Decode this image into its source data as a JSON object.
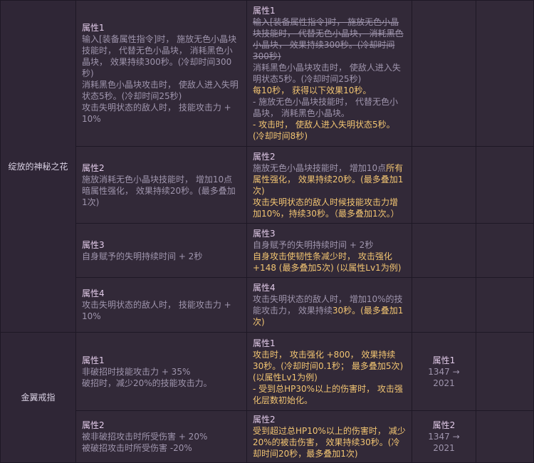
{
  "items": [
    {
      "name": "绽放的神秘之花",
      "rows": [
        {
          "old": {
            "title": "属性1",
            "lines": [
              "输入[装备属性指令]时， 施放无色小晶块技能时， 代替无色小晶块， 消耗黑色小晶块， 效果持续300秒。(冷却时间300秒)",
              "消耗黑色小晶块攻击时， 使敌人进入失明状态5秒。(冷却时间25秒)",
              "攻击失明状态的敌人时， 技能攻击力 + 10%"
            ]
          },
          "new": {
            "title": "属性1",
            "struck": "输入[装备属性指令]时， 施放无色小晶块技能时， 代替无色小晶块， 消耗黑色小晶块， 效果持续300秒。(冷却时间300秒)",
            "gray": "消耗黑色小晶块攻击时， 使敌人进入失明状态5秒。(冷却时间25秒)",
            "y1": "每10秒， 获得以下效果10秒。",
            "gray2": "- 施放无色小晶块技能时， 代替无色小晶块， 消耗黑色小晶块。",
            "y2": "- 攻击时， 使敌人进入失明状态5秒。(冷却时间8秒)"
          }
        },
        {
          "old": {
            "title": "属性2",
            "lines": [
              "施放消耗无色小晶块技能时， 增加10点暗属性强化， 效果持续20秒。(最多叠加1次)"
            ]
          },
          "new": {
            "title": "属性2",
            "gray": "施放无色小晶块技能时， 增加10点",
            "y_inline": "所有属性强化， 效果持续20秒。(最多叠加1次)",
            "y2": "攻击失明状态的敌人时候技能攻击力增加10%，持续30秒。（最多叠加1次。）"
          }
        },
        {
          "old": {
            "title": "属性3",
            "lines": [
              "自身赋予的失明持续时间 + 2秒"
            ]
          },
          "new": {
            "title": "属性3",
            "gray": "自身赋予的失明持续时间 + 2秒",
            "y2": "自身攻击使韧性条减少时， 攻击强化 +148 (最多叠加5次) (以属性Lv1为例)"
          }
        },
        {
          "old": {
            "title": "属性4",
            "lines": [
              "攻击失明状态的敌人时， 技能攻击力 + 10%"
            ]
          },
          "new": {
            "title": "属性4",
            "gray": "攻击失明状态的敌人时， 增加10%的技能攻击力， 效果持续",
            "y_inline": "30秒。(最多叠加1次)"
          }
        }
      ]
    },
    {
      "name": "金翼戒指",
      "rows": [
        {
          "old": {
            "title": "属性1",
            "lines": [
              "非破招时技能攻击力 + 35%",
              "破招时，减少20%的技能攻击力。"
            ]
          },
          "new": {
            "title": "属性1",
            "y1": "攻击时， 攻击强化 +800， 效果持续30秒。(冷却时间0.1秒； 最多叠加5次)(以属性Lv1为例)",
            "y2": "- 受到总HP30%以上的伤害时， 攻击强化层数初始化。"
          },
          "num": {
            "title": "属性1",
            "value": "1347 → 2021"
          }
        },
        {
          "old": {
            "title": "属性2",
            "lines": [
              "被非破招攻击时所受伤害 + 20%",
              "被破招攻击时所受伤害 -20%"
            ]
          },
          "new": {
            "title": "属性2",
            "y1": "受到超过总HP10%以上的伤害时， 减少20%的被击伤害， 效果持续30秒。(冷却时间20秒，最多叠加1次)"
          },
          "num": {
            "title": "属性2",
            "value": "1347 → 2021"
          }
        }
      ]
    }
  ]
}
